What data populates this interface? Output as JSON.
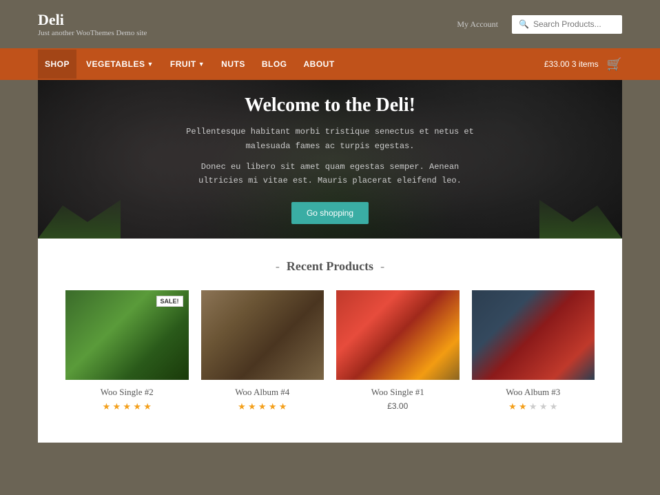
{
  "site": {
    "title": "Deli",
    "tagline": "Just another WooThemes Demo site"
  },
  "header": {
    "my_account_label": "My Account",
    "search_placeholder": "Search Products..."
  },
  "nav": {
    "items": [
      {
        "label": "SHOP",
        "active": true,
        "has_dropdown": false
      },
      {
        "label": "VEGETABLES",
        "active": false,
        "has_dropdown": true
      },
      {
        "label": "FRUIT",
        "active": false,
        "has_dropdown": true
      },
      {
        "label": "NUTS",
        "active": false,
        "has_dropdown": false
      },
      {
        "label": "BLOG",
        "active": false,
        "has_dropdown": false
      },
      {
        "label": "ABOUT",
        "active": false,
        "has_dropdown": false
      }
    ],
    "cart_amount": "£33.00",
    "cart_items_label": "3 items"
  },
  "hero": {
    "title": "Welcome to the Deli!",
    "text1": "Pellentesque habitant morbi tristique senectus et netus et malesuada fames\nac turpis egestas.",
    "text2": "Donec eu libero sit amet quam egestas semper. Aenean ultricies mi vitae est.\nMauris placerat eleifend leo.",
    "cta_label": "Go shopping"
  },
  "recent_products": {
    "section_title": "Recent Products",
    "products": [
      {
        "id": 1,
        "name": "Woo Single #2",
        "img_type": "plant",
        "sale": true,
        "rating": 4.5,
        "stars_filled": 4,
        "stars_half": 1,
        "stars_empty": 0,
        "price": null
      },
      {
        "id": 2,
        "name": "Woo Album #4",
        "img_type": "roots",
        "sale": false,
        "rating": 5,
        "stars_filled": 5,
        "stars_half": 0,
        "stars_empty": 0,
        "price": null
      },
      {
        "id": 3,
        "name": "Woo Single #1",
        "img_type": "rhubarb",
        "sale": false,
        "rating": 0,
        "stars_filled": 0,
        "stars_half": 0,
        "stars_empty": 0,
        "price": "£3.00"
      },
      {
        "id": 4,
        "name": "Woo Album #3",
        "img_type": "jam",
        "sale": false,
        "rating": 2.5,
        "stars_filled": 2,
        "stars_half": 1,
        "stars_empty": 2,
        "price": null
      }
    ]
  }
}
